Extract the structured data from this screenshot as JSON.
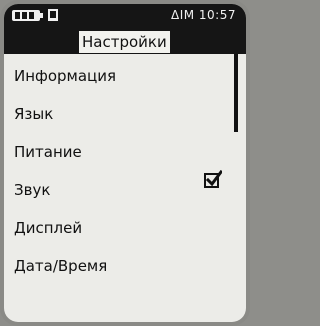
{
  "status": {
    "time_text": "ΔIM 10:57",
    "icons": [
      "battery-icon",
      "flag-icon"
    ]
  },
  "header": {
    "title": "Настройки"
  },
  "menu": {
    "items": [
      {
        "label": "Информация"
      },
      {
        "label": "Язык"
      },
      {
        "label": "Питание"
      },
      {
        "label": "Звук",
        "checked": true
      },
      {
        "label": "Дисплей"
      },
      {
        "label": "Дата/Время"
      }
    ]
  },
  "colors": {
    "bar_bg": "#151515",
    "screen_bg": "#ecece8",
    "text": "#111111"
  }
}
